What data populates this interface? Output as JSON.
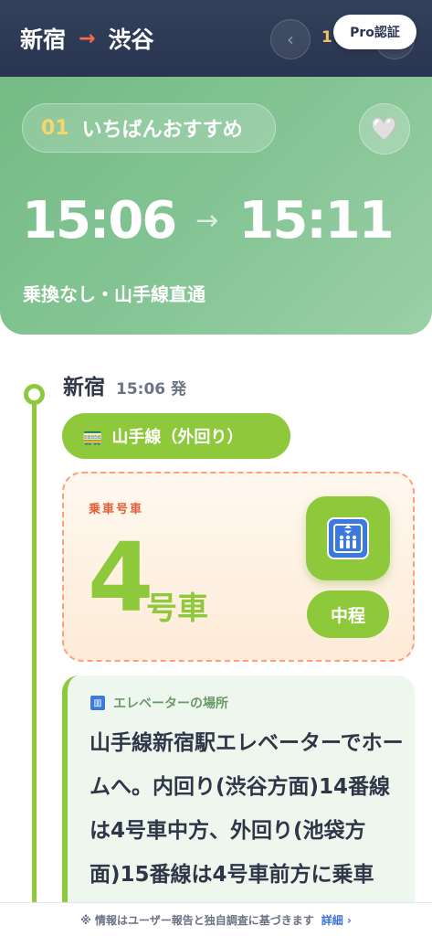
{
  "header": {
    "from": "新宿",
    "to": "渋谷",
    "arrow": "→",
    "prev_icon": "‹",
    "next_icon": "›",
    "page_number": "1",
    "pro_label": "Pro認証"
  },
  "hero": {
    "rank_number": "01",
    "rank_label": "いちばんおすすめ",
    "favorite_icon": "heart-icon",
    "depart_time": "15:06",
    "arrive_time": "15:11",
    "time_arrow": "→",
    "summary": "乗換なし・山手線直通"
  },
  "station": {
    "name": "新宿",
    "time": "15:06 発"
  },
  "line": {
    "name": "山手線（外回り）",
    "icon": "🚃"
  },
  "car": {
    "label": "乗車号車",
    "number": "4",
    "unit": "号車",
    "position": "中程"
  },
  "info": {
    "title": "エレベーターの場所",
    "text": "山手線新宿駅エレベーターでホームへ。内回り(渋谷方面)14番線は4号車中方、外回り(池袋方面)15番線は4号車前方に乗車"
  },
  "footer": {
    "text": "※ 情報はユーザー報告と独自調査に基づきます",
    "link": "詳細 ›"
  },
  "colors": {
    "header_bg": "#2f3b55",
    "accent_green": "#8ec83b",
    "hero_green": "#86c596",
    "arrow_orange": "#ff6b4a",
    "dashed_border": "#ff9f7a",
    "link_blue": "#3d73d9"
  }
}
